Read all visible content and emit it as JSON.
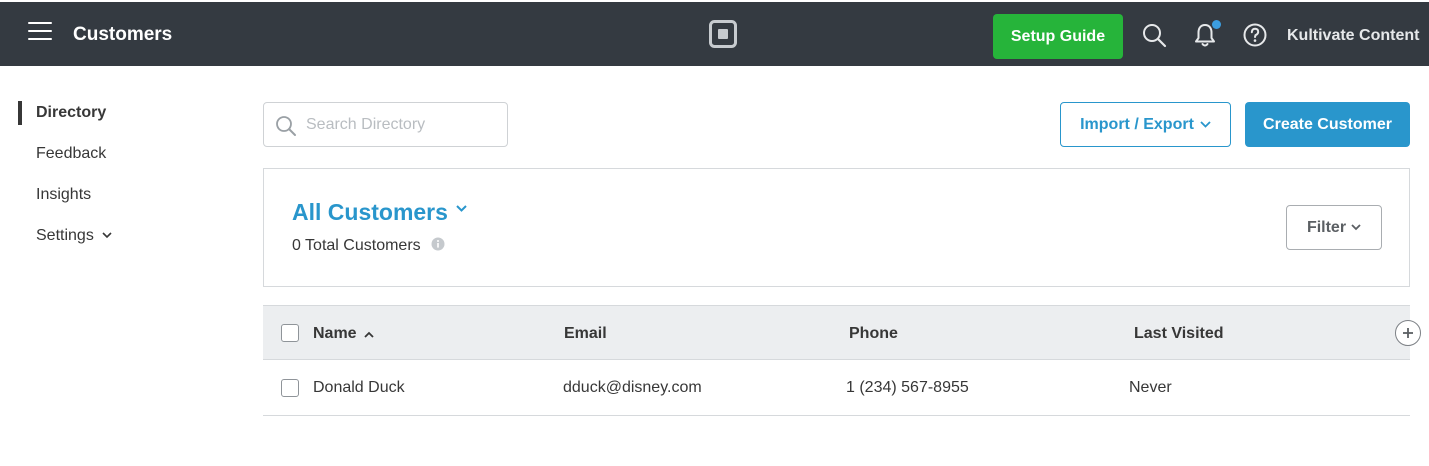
{
  "topbar": {
    "title": "Customers",
    "setup_guide_label": "Setup Guide",
    "account_name": "Kultivate Content",
    "bg_color": "#343a41",
    "notification_dot_color": "#3c9ee0"
  },
  "sidebar": {
    "items": [
      {
        "label": "Directory",
        "active": true
      },
      {
        "label": "Feedback",
        "active": false
      },
      {
        "label": "Insights",
        "active": false
      },
      {
        "label": "Settings",
        "active": false,
        "has_dropdown": true
      }
    ]
  },
  "toolbar": {
    "search_placeholder": "Search Directory",
    "search_value": "",
    "import_export_label": "Import / Export",
    "create_customer_label": "Create Customer"
  },
  "customers_panel": {
    "title": "All Customers",
    "total_count_text": "0 Total Customers",
    "filter_label": "Filter"
  },
  "table": {
    "columns": [
      "Name",
      "Email",
      "Phone",
      "Last Visited"
    ],
    "sort_column": "Name",
    "sort_direction": "ascending",
    "rows": [
      {
        "name": "Donald Duck",
        "email": "dduck@disney.com",
        "phone": "1 (234) 567-8955",
        "last_visited": "Never"
      }
    ]
  },
  "colors": {
    "accent_blue": "#2996cc",
    "setup_green": "#26b43a"
  },
  "icons": [
    "hamburger-menu-icon",
    "square-logo-icon",
    "search-icon",
    "bell-icon",
    "help-icon",
    "chevron-down-icon",
    "info-icon",
    "chevron-up-icon",
    "plus-icon"
  ]
}
